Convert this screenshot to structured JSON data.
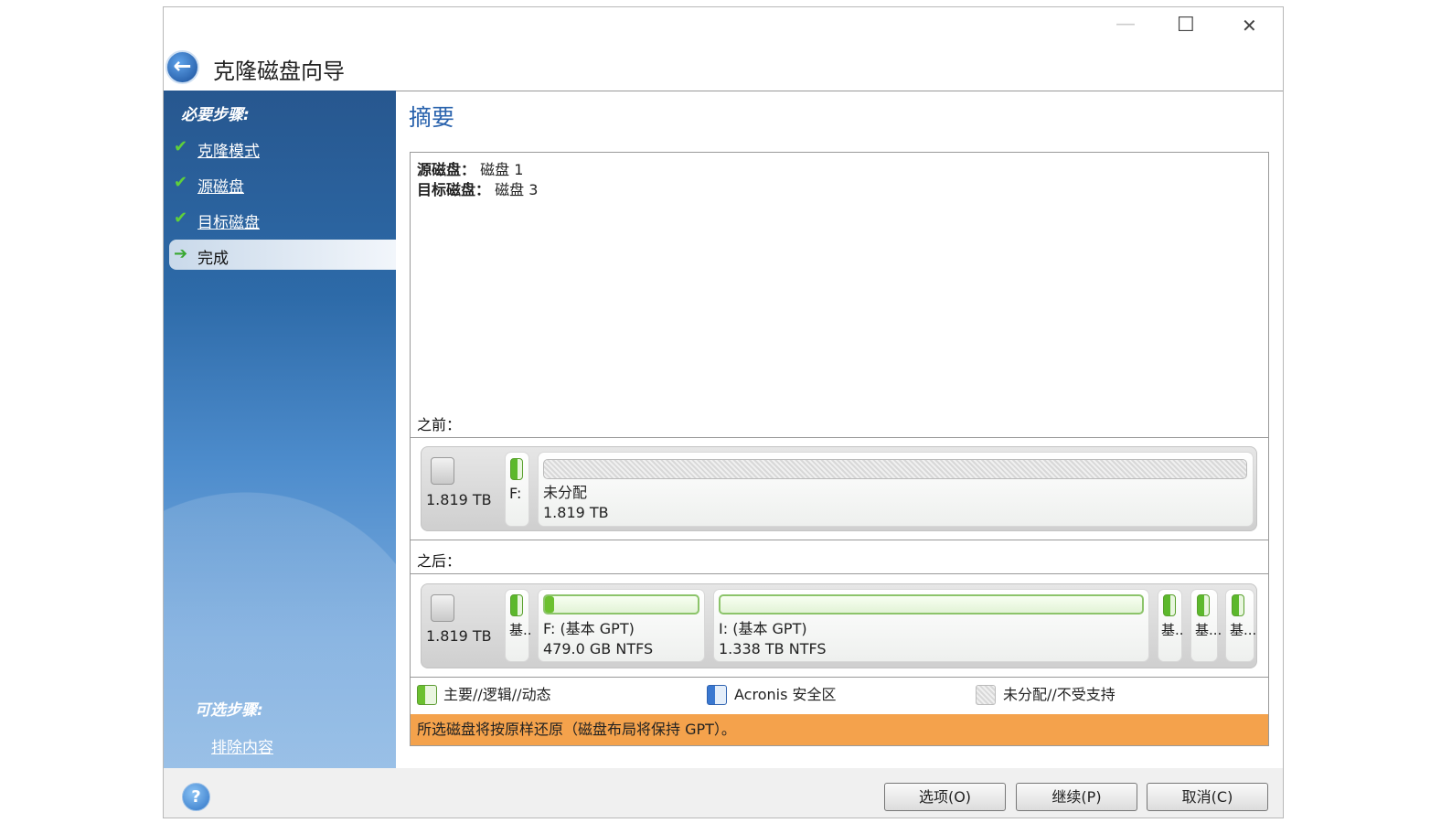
{
  "window": {
    "title": "克隆磁盘向导",
    "controls": {
      "minimize": "—",
      "maximize": "☐",
      "close": "✕"
    }
  },
  "sidebar": {
    "required_heading": "必要步骤:",
    "steps": [
      {
        "label": "克隆模式",
        "state": "done"
      },
      {
        "label": "源磁盘",
        "state": "done"
      },
      {
        "label": "目标磁盘",
        "state": "done"
      },
      {
        "label": "完成",
        "state": "current"
      }
    ],
    "optional_heading": "可选步骤:",
    "optional_steps": [
      {
        "label": "排除内容"
      }
    ]
  },
  "main": {
    "title": "摘要",
    "source_label": "源磁盘：",
    "source_value": "磁盘 1",
    "target_label": "目标磁盘：",
    "target_value": "磁盘 3",
    "before": {
      "label": "之前：",
      "disk_size": "1.819 TB",
      "partitions": [
        {
          "label": "F:"
        },
        {
          "name": "未分配",
          "size": "1.819 TB",
          "type": "unallocated"
        }
      ]
    },
    "after": {
      "label": "之后：",
      "disk_size": "1.819 TB",
      "partitions": [
        {
          "label": "基.."
        },
        {
          "name": "F: (基本 GPT)",
          "size": "479.0 GB  NTFS"
        },
        {
          "name": "I: (基本 GPT)",
          "size": "1.338 TB  NTFS"
        },
        {
          "label": "基.."
        },
        {
          "label": "基..."
        },
        {
          "label": "基..."
        }
      ]
    },
    "legend": [
      {
        "label": "主要//逻辑//动态",
        "color": "#6cc030"
      },
      {
        "label": "Acronis 安全区",
        "color": "#3a78d0"
      },
      {
        "label": "未分配//不受支持",
        "color": "#d0d0d0"
      }
    ],
    "notice": "所选磁盘将按原样还原（磁盘布局将保持 GPT）。",
    "notice_color": "#f4a24c"
  },
  "footer": {
    "options": "选项(O)",
    "continue": "继续(P)",
    "cancel": "取消(C)"
  }
}
